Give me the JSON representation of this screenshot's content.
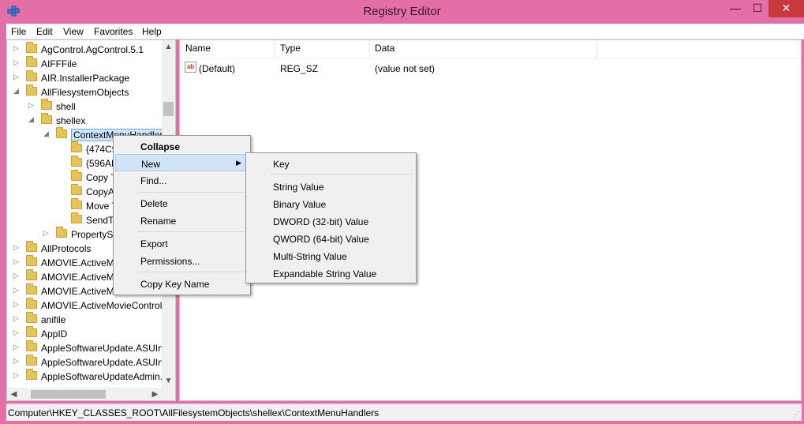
{
  "window": {
    "title": "Registry Editor",
    "minimize": "—",
    "maximize": "☐",
    "close": "✕"
  },
  "menubar": [
    "File",
    "Edit",
    "View",
    "Favorites",
    "Help"
  ],
  "tree": {
    "items": [
      {
        "label": "AgControl.AgControl.5.1",
        "state": "collapsed"
      },
      {
        "label": "AIFFFile",
        "state": "collapsed"
      },
      {
        "label": "AIR.InstallerPackage",
        "state": "collapsed"
      },
      {
        "label": "AllFilesystemObjects",
        "state": "expanded"
      },
      {
        "label": "shell",
        "state": "collapsed"
      },
      {
        "label": "shellex",
        "state": "expanded"
      },
      {
        "label": "ContextMenuHandlers",
        "state": "expanded",
        "selected": true
      },
      {
        "label": "{474C9",
        "state": "none"
      },
      {
        "label": "{596AB",
        "state": "none"
      },
      {
        "label": "Copy T",
        "state": "none"
      },
      {
        "label": "CopyA",
        "state": "none"
      },
      {
        "label": "Move T",
        "state": "none"
      },
      {
        "label": "SendTo",
        "state": "none"
      },
      {
        "label": "PropertySh",
        "state": "collapsed"
      },
      {
        "label": "AllProtocols",
        "state": "collapsed"
      },
      {
        "label": "AMOVIE.ActiveMo",
        "state": "collapsed"
      },
      {
        "label": "AMOVIE.ActiveMo",
        "state": "collapsed"
      },
      {
        "label": "AMOVIE.ActiveMo",
        "state": "collapsed"
      },
      {
        "label": "AMOVIE.ActiveMovieControl.",
        "state": "collapsed"
      },
      {
        "label": "anifile",
        "state": "collapsed"
      },
      {
        "label": "AppID",
        "state": "collapsed"
      },
      {
        "label": "AppleSoftwareUpdate.ASUIns",
        "state": "collapsed"
      },
      {
        "label": "AppleSoftwareUpdate.ASUIns",
        "state": "collapsed"
      },
      {
        "label": "AppleSoftwareUpdateAdmin.",
        "state": "collapsed"
      }
    ]
  },
  "list": {
    "headers": {
      "name": "Name",
      "type": "Type",
      "data": "Data"
    },
    "rows": [
      {
        "icon": "ab",
        "name": "(Default)",
        "type": "REG_SZ",
        "data": "(value not set)"
      }
    ]
  },
  "context_menu": {
    "items": [
      {
        "label": "Collapse",
        "bold": true
      },
      {
        "label": "New",
        "submenu": true,
        "hover": true
      },
      {
        "label": "Find..."
      },
      {
        "label": "Delete"
      },
      {
        "label": "Rename"
      },
      {
        "label": "Export"
      },
      {
        "label": "Permissions..."
      },
      {
        "label": "Copy Key Name"
      }
    ]
  },
  "new_submenu": {
    "items": [
      "Key",
      "String Value",
      "Binary Value",
      "DWORD (32-bit) Value",
      "QWORD (64-bit) Value",
      "Multi-String Value",
      "Expandable String Value"
    ]
  },
  "statusbar": {
    "path": "Computer\\HKEY_CLASSES_ROOT\\AllFilesystemObjects\\shellex\\ContextMenuHandlers"
  },
  "colors": {
    "titlebar": "#e36fa6",
    "close_button": "#c7383f",
    "selection": "#cce4f7",
    "folder": "#e8c35a"
  }
}
